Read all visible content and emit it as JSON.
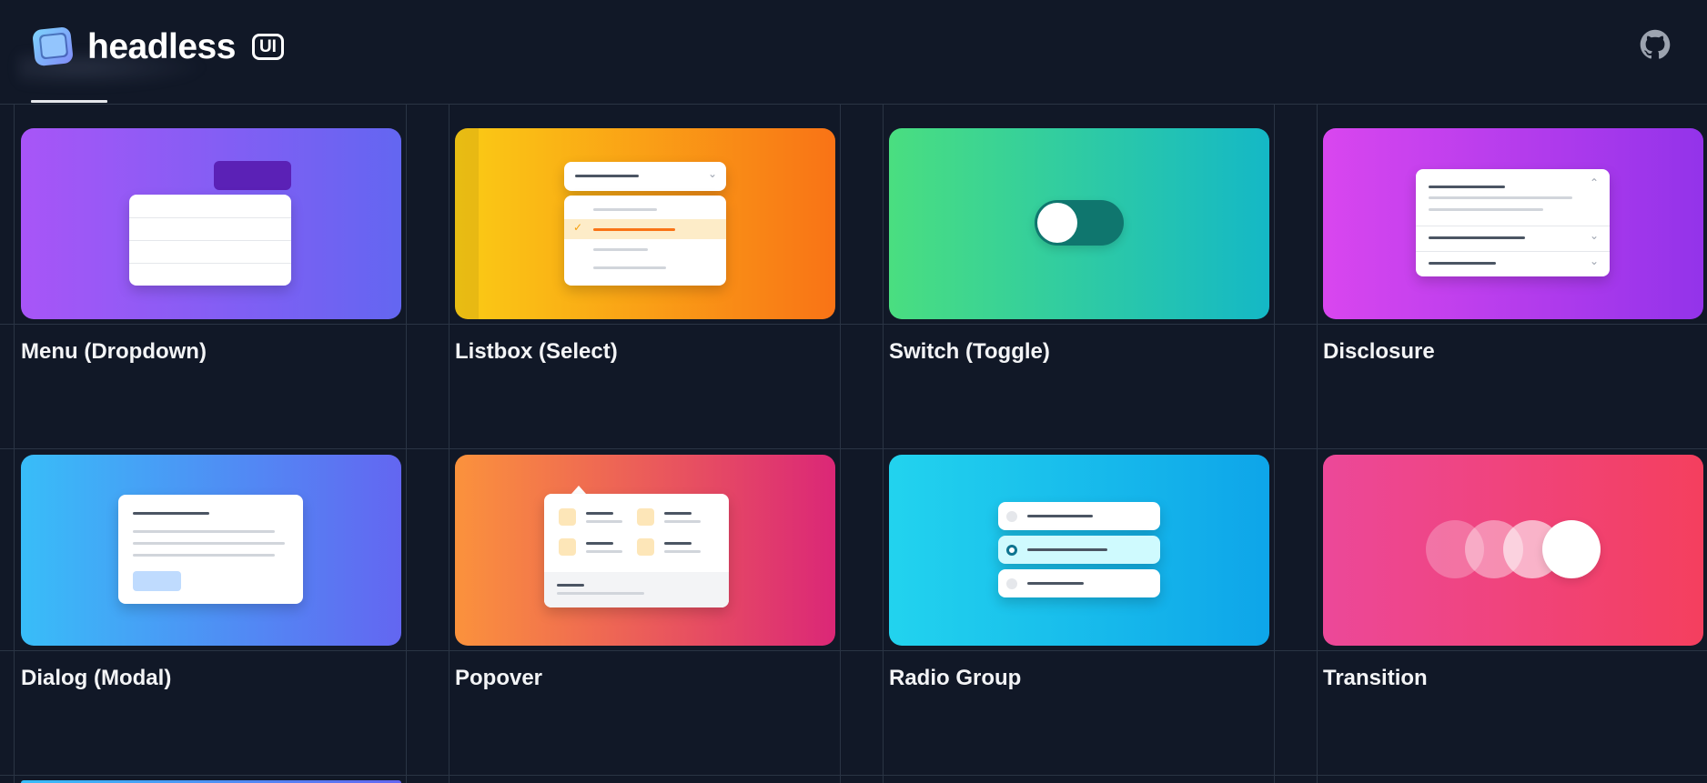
{
  "header": {
    "brand_name": "headless",
    "brand_badge": "UI",
    "logo_icon": "headless-logo-icon",
    "github_icon": "github-icon"
  },
  "components": [
    {
      "label": "Menu (Dropdown)",
      "colors": [
        "#a855f7",
        "#6366f1"
      ]
    },
    {
      "label": "Listbox (Select)",
      "colors": [
        "#facc15",
        "#f97316"
      ]
    },
    {
      "label": "Switch (Toggle)",
      "colors": [
        "#4ade80",
        "#14b8c6"
      ]
    },
    {
      "label": "Disclosure",
      "colors": [
        "#d946ef",
        "#9333ea"
      ]
    },
    {
      "label": "Dialog (Modal)",
      "colors": [
        "#38bdf8",
        "#6366f1"
      ]
    },
    {
      "label": "Popover",
      "colors": [
        "#fb923c",
        "#db2777"
      ]
    },
    {
      "label": "Radio Group",
      "colors": [
        "#22d3ee",
        "#0ea5e9"
      ]
    },
    {
      "label": "Transition",
      "colors": [
        "#ec4899",
        "#f43f5e"
      ]
    }
  ]
}
